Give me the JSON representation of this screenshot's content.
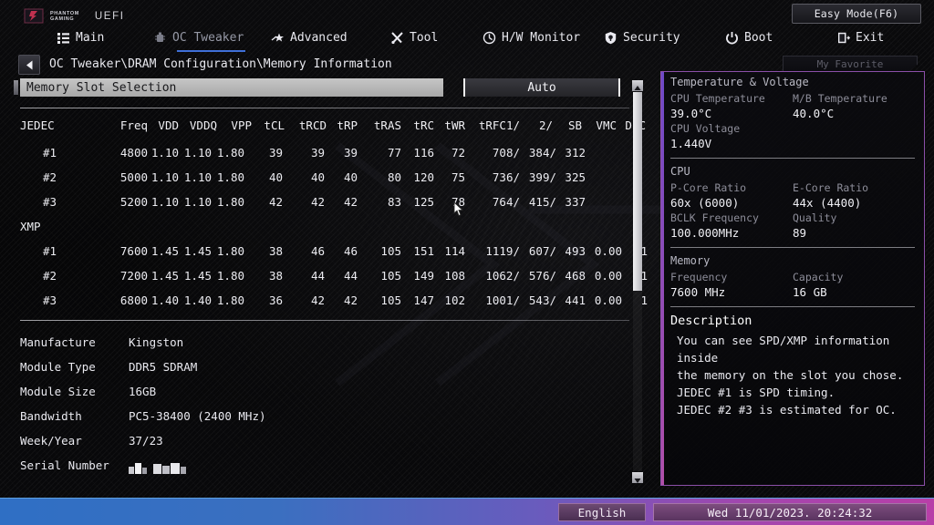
{
  "brand": {
    "logo_line1": "PHANTOM",
    "logo_line2": "GAMING",
    "uefi": "UEFI"
  },
  "header": {
    "easy_mode_label": "Easy Mode(F6)",
    "my_favorite_label": "My Favorite",
    "nav": [
      {
        "label": "Main",
        "icon": "list-icon",
        "active": false
      },
      {
        "label": "OC Tweaker",
        "icon": "chip-icon",
        "active": true
      },
      {
        "label": "Advanced",
        "icon": "star-arrow-icon",
        "active": false
      },
      {
        "label": "Tool",
        "icon": "tools-icon",
        "active": false
      },
      {
        "label": "H/W Monitor",
        "icon": "gauge-icon",
        "active": false
      },
      {
        "label": "Security",
        "icon": "shield-icon",
        "active": false
      },
      {
        "label": "Boot",
        "icon": "power-icon",
        "active": false
      },
      {
        "label": "Exit",
        "icon": "exit-door-icon",
        "active": false
      }
    ]
  },
  "breadcrumb": {
    "back_icon": "back-arrow-icon",
    "path": "OC Tweaker\\DRAM Configuration\\Memory Information"
  },
  "selection": {
    "label": "Memory Slot Selection",
    "value": "Auto"
  },
  "table": {
    "columns": [
      "JEDEC",
      "Freq",
      "VDD",
      "VDDQ",
      "VPP",
      "tCL",
      "tRCD",
      "tRP",
      "tRAS",
      "tRC",
      "tWR",
      "tRFC1/",
      "2/",
      "SB",
      "VMC",
      "DPC"
    ],
    "groups": [
      {
        "name": "",
        "rows": [
          {
            "id": "#1",
            "freq": "4800",
            "vdd": "1.10",
            "vddq": "1.10",
            "vpp": "1.80",
            "tcl": "39",
            "trcd": "39",
            "trp": "39",
            "tras": "77",
            "trc": "116",
            "twr": "72",
            "trfc1": "708/",
            "trfc2": "384/",
            "sb": "312",
            "vmc": "",
            "dpc": ""
          },
          {
            "id": "#2",
            "freq": "5000",
            "vdd": "1.10",
            "vddq": "1.10",
            "vpp": "1.80",
            "tcl": "40",
            "trcd": "40",
            "trp": "40",
            "tras": "80",
            "trc": "120",
            "twr": "75",
            "trfc1": "736/",
            "trfc2": "399/",
            "sb": "325",
            "vmc": "",
            "dpc": ""
          },
          {
            "id": "#3",
            "freq": "5200",
            "vdd": "1.10",
            "vddq": "1.10",
            "vpp": "1.80",
            "tcl": "42",
            "trcd": "42",
            "trp": "42",
            "tras": "83",
            "trc": "125",
            "twr": "78",
            "trfc1": "764/",
            "trfc2": "415/",
            "sb": "337",
            "vmc": "",
            "dpc": ""
          }
        ]
      },
      {
        "name": "XMP",
        "rows": [
          {
            "id": "#1",
            "freq": "7600",
            "vdd": "1.45",
            "vddq": "1.45",
            "vpp": "1.80",
            "tcl": "38",
            "trcd": "46",
            "trp": "46",
            "tras": "105",
            "trc": "151",
            "twr": "114",
            "trfc1": "1119/",
            "trfc2": "607/",
            "sb": "493",
            "vmc": "0.00",
            "dpc": "1"
          },
          {
            "id": "#2",
            "freq": "7200",
            "vdd": "1.45",
            "vddq": "1.45",
            "vpp": "1.80",
            "tcl": "38",
            "trcd": "44",
            "trp": "44",
            "tras": "105",
            "trc": "149",
            "twr": "108",
            "trfc1": "1062/",
            "trfc2": "576/",
            "sb": "468",
            "vmc": "0.00",
            "dpc": "1"
          },
          {
            "id": "#3",
            "freq": "6800",
            "vdd": "1.40",
            "vddq": "1.40",
            "vpp": "1.80",
            "tcl": "36",
            "trcd": "42",
            "trp": "42",
            "tras": "105",
            "trc": "147",
            "twr": "102",
            "trfc1": "1001/",
            "trfc2": "543/",
            "sb": "441",
            "vmc": "0.00",
            "dpc": "1"
          }
        ]
      }
    ]
  },
  "module_info": [
    {
      "label": "Manufacture",
      "value": "Kingston"
    },
    {
      "label": "Module Type",
      "value": "DDR5 SDRAM"
    },
    {
      "label": "Module Size",
      "value": "16GB"
    },
    {
      "label": "Bandwidth",
      "value": "PC5-38400  (2400 MHz)"
    },
    {
      "label": "Week/Year",
      "value": "37/23"
    },
    {
      "label": "Serial Number",
      "value": ""
    }
  ],
  "right_panel": {
    "temp_voltage": {
      "title": "Temperature & Voltage",
      "cpu_temp_label": "CPU Temperature",
      "cpu_temp_value": "39.0°C",
      "mb_temp_label": "M/B Temperature",
      "mb_temp_value": "40.0°C",
      "cpu_voltage_label": "CPU Voltage",
      "cpu_voltage_value": "1.440V"
    },
    "cpu": {
      "title": "CPU",
      "pcore_label": "P-Core Ratio",
      "pcore_value": "60x (6000)",
      "ecore_label": "E-Core Ratio",
      "ecore_value": "44x (4400)",
      "bclk_label": "BCLK Frequency",
      "bclk_value": "100.000MHz",
      "quality_label": "Quality",
      "quality_value": "89"
    },
    "memory": {
      "title": "Memory",
      "freq_label": "Frequency",
      "freq_value": "7600 MHz",
      "cap_label": "Capacity",
      "cap_value": "16 GB"
    },
    "description": {
      "title": "Description",
      "body": "You can see SPD/XMP information inside\nthe memory on the slot you chose.\nJEDEC #1 is SPD timing.\nJEDEC #2 #3 is estimated for OC."
    }
  },
  "status_bar": {
    "language": "English",
    "datetime": "Wed 11/01/2023. 20:24:32"
  },
  "colors": {
    "accent_blue": "#3f6fd8",
    "panel_border": "#8b4fa8",
    "bar_left": "#2f6fc4",
    "bar_right": "#b83fa8",
    "text": "#e9e9ef"
  }
}
